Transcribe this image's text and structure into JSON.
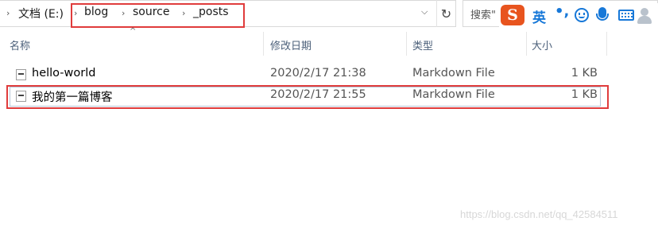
{
  "address": {
    "drive": "文档 (E:)",
    "crumbs": [
      "blog",
      "source",
      "_posts"
    ]
  },
  "search": {
    "placeholder": "搜索\""
  },
  "ime": {
    "logo": "S",
    "mode": "英",
    "punct": "•,",
    "icons": [
      "smile-icon",
      "microphone-icon",
      "keyboard-icon",
      "user-icon"
    ]
  },
  "columns": {
    "name": "名称",
    "modified": "修改日期",
    "type": "类型",
    "size": "大小"
  },
  "files": [
    {
      "name": "hello-world",
      "modified": "2020/2/17 21:38",
      "type": "Markdown File",
      "size": "1 KB"
    },
    {
      "name": "我的第一篇博客",
      "modified": "2020/2/17 21:55",
      "type": "Markdown File",
      "size": "1 KB"
    }
  ],
  "colors": {
    "highlight": "#e03c3c",
    "ime_accent": "#1778d8",
    "ime_logo": "#e8541e"
  },
  "watermark": "https://blog.csdn.net/qq_42584511"
}
